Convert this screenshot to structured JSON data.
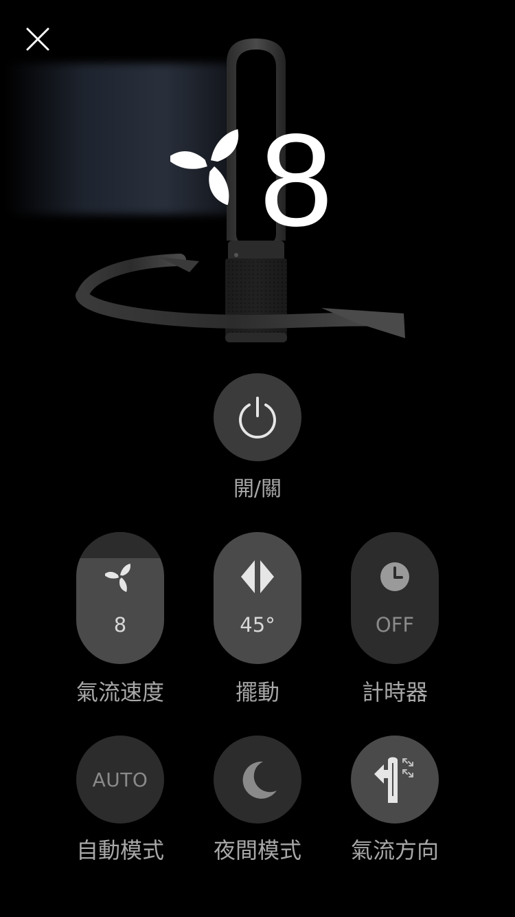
{
  "header": {
    "close_icon": "close-icon"
  },
  "hero": {
    "fan_speed": "8",
    "fan_icon": "fan-icon",
    "rotation_icon": "oscillation-arrow-icon"
  },
  "power": {
    "label": "開/關",
    "icon": "power-icon"
  },
  "controls": {
    "airflow_speed": {
      "label": "氣流速度",
      "value": "8",
      "icon": "fan-icon"
    },
    "oscillation": {
      "label": "擺動",
      "value": "45°",
      "icon": "oscillation-icon"
    },
    "timer": {
      "label": "計時器",
      "value": "OFF",
      "icon": "clock-icon"
    },
    "auto_mode": {
      "label": "自動模式",
      "text": "AUTO"
    },
    "night_mode": {
      "label": "夜間模式",
      "icon": "moon-icon"
    },
    "airflow_direction": {
      "label": "氣流方向",
      "icon": "airflow-direction-icon"
    }
  },
  "colors": {
    "background": "#000000",
    "active_button": "#4a4a4a",
    "inactive_button": "#2c2c2c",
    "label_text": "#a8a8a8"
  }
}
